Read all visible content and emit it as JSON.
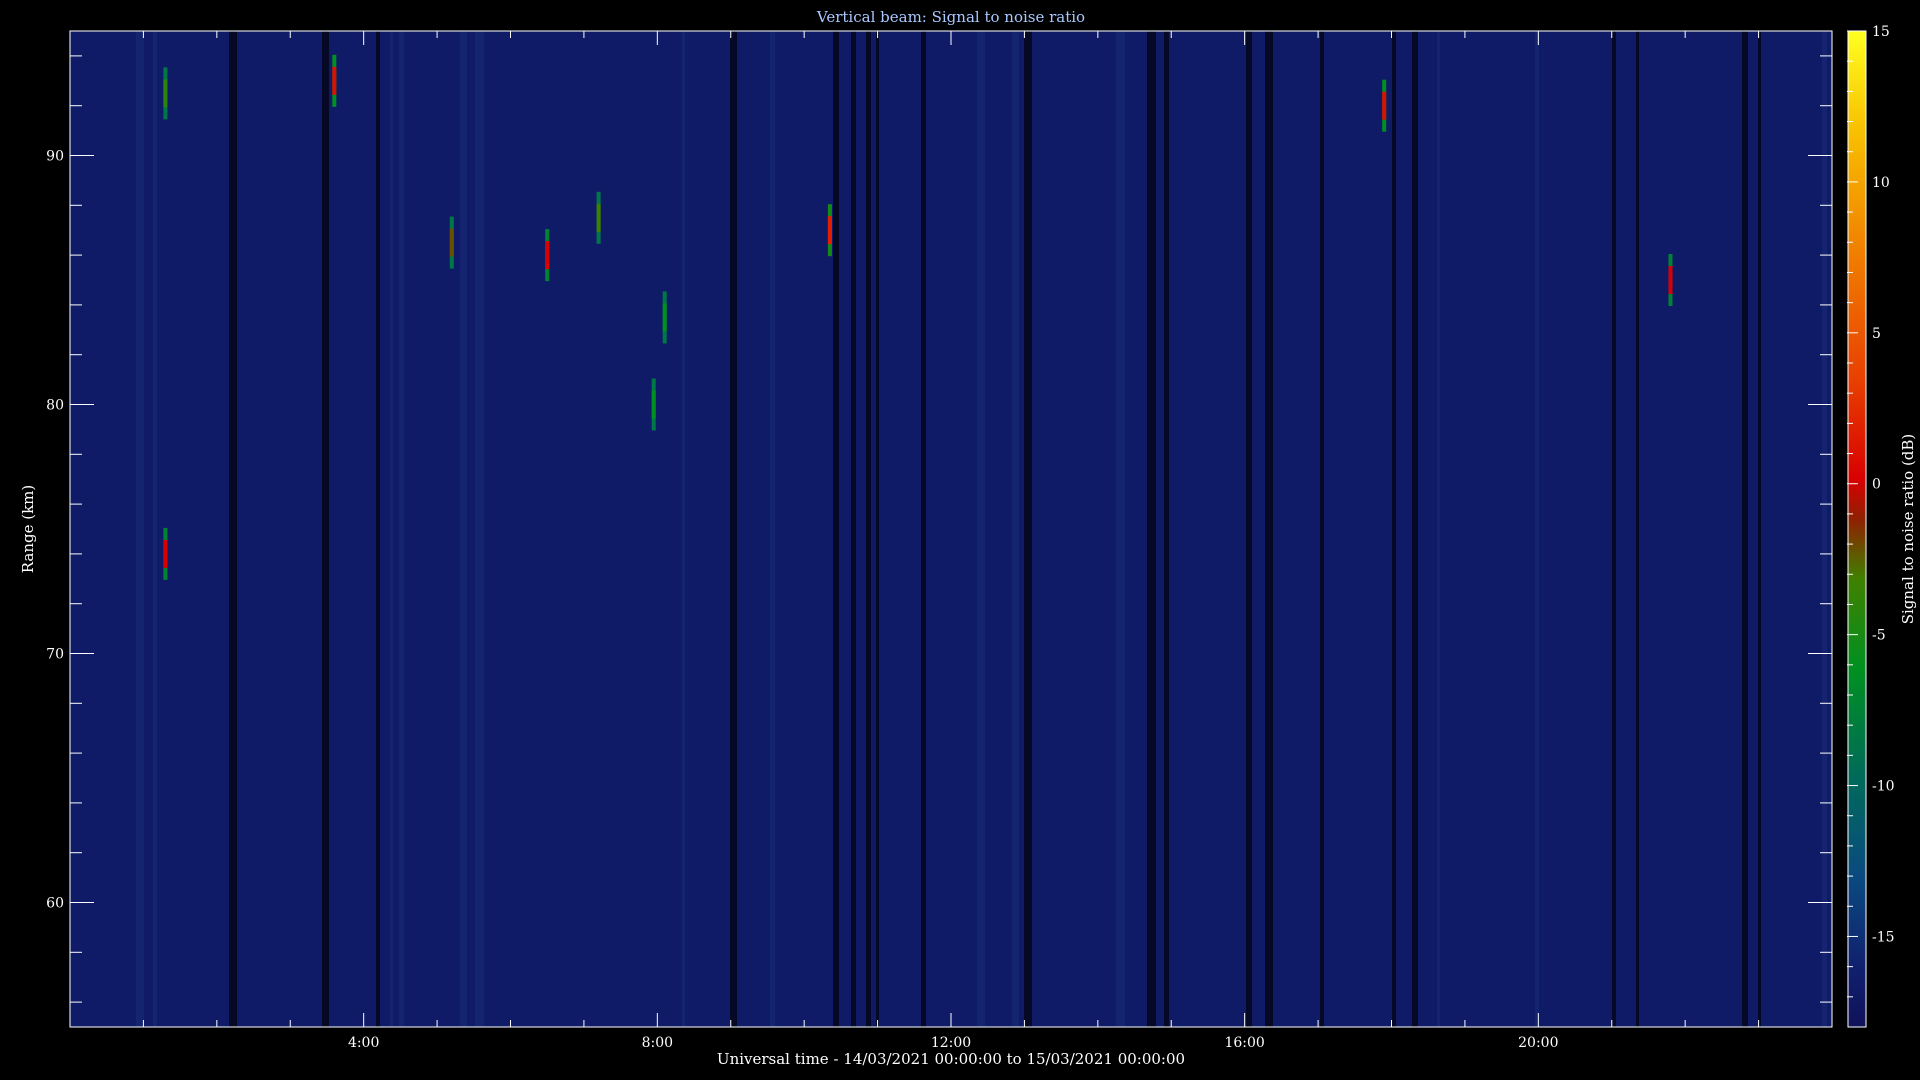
{
  "chart_data": {
    "type": "heatmap",
    "title": "Vertical beam: Signal to noise ratio",
    "xlabel": "Universal time - 14/03/2021 00:00:00 to 15/03/2021 00:00:00",
    "ylabel": "Range (km)",
    "colorbar_label": "Signal to noise ratio (dB)",
    "x_range_hours": [
      0,
      24
    ],
    "x_ticks": [
      {
        "value": 4,
        "label": "4:00"
      },
      {
        "value": 8,
        "label": "8:00"
      },
      {
        "value": 12,
        "label": "12:00"
      },
      {
        "value": 16,
        "label": "16:00"
      },
      {
        "value": 20,
        "label": "20:00"
      }
    ],
    "ylim": [
      55,
      95
    ],
    "y_ticks": [
      {
        "value": 60,
        "label": "60"
      },
      {
        "value": 70,
        "label": "70"
      },
      {
        "value": 80,
        "label": "80"
      },
      {
        "value": 90,
        "label": "90"
      }
    ],
    "colorbar_range": [
      -18,
      15
    ],
    "colorbar_ticks": [
      {
        "value": 15,
        "label": "15"
      },
      {
        "value": 10,
        "label": "10"
      },
      {
        "value": 5,
        "label": "5"
      },
      {
        "value": 0,
        "label": "0"
      },
      {
        "value": -5,
        "label": "-5"
      },
      {
        "value": -10,
        "label": "-10"
      },
      {
        "value": -15,
        "label": "-15"
      }
    ],
    "background_level_db": -16,
    "echoes": [
      {
        "time_h": 1.3,
        "range_km": 92.5,
        "snr_db": -4
      },
      {
        "time_h": 1.3,
        "range_km": 74,
        "snr_db": 0
      },
      {
        "time_h": 3.6,
        "range_km": 93,
        "snr_db": 1
      },
      {
        "time_h": 5.2,
        "range_km": 86.5,
        "snr_db": -2
      },
      {
        "time_h": 6.5,
        "range_km": 86,
        "snr_db": 0
      },
      {
        "time_h": 7.2,
        "range_km": 87.5,
        "snr_db": -3
      },
      {
        "time_h": 7.95,
        "range_km": 80,
        "snr_db": -6
      },
      {
        "time_h": 8.1,
        "range_km": 83.5,
        "snr_db": -6
      },
      {
        "time_h": 10.35,
        "range_km": 87,
        "snr_db": 2
      },
      {
        "time_h": 17.9,
        "range_km": 92,
        "snr_db": 1
      },
      {
        "time_h": 21.8,
        "range_km": 85,
        "snr_db": 0
      }
    ]
  }
}
